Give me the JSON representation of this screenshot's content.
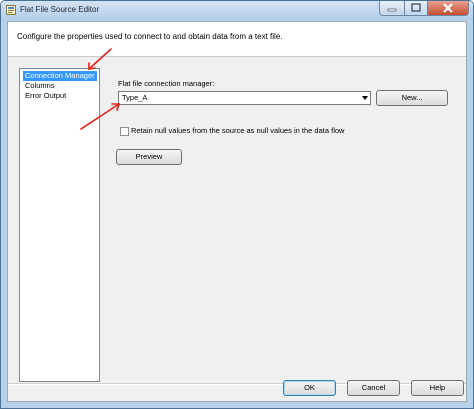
{
  "window": {
    "title": "Flat File Source Editor"
  },
  "header": {
    "description": "Configure the properties used to connect to and obtain data from a text file."
  },
  "nav": {
    "items": [
      "Connection Manager",
      "Columns",
      "Error Output"
    ]
  },
  "form": {
    "connection_label": "Flat file connection manager:",
    "connection_value": "Type_A",
    "new_label": "New...",
    "retain_nulls_label": "Retain null values from the source as null values in the data flow",
    "retain_nulls_checked": false,
    "preview_label": "Preview"
  },
  "footer": {
    "ok_label": "OK",
    "cancel_label": "Cancel",
    "help_label": "Help"
  },
  "colors": {
    "selection": "#3399ff",
    "annotation_arrow": "#e0241b",
    "title_bar": "#c4daf0"
  }
}
